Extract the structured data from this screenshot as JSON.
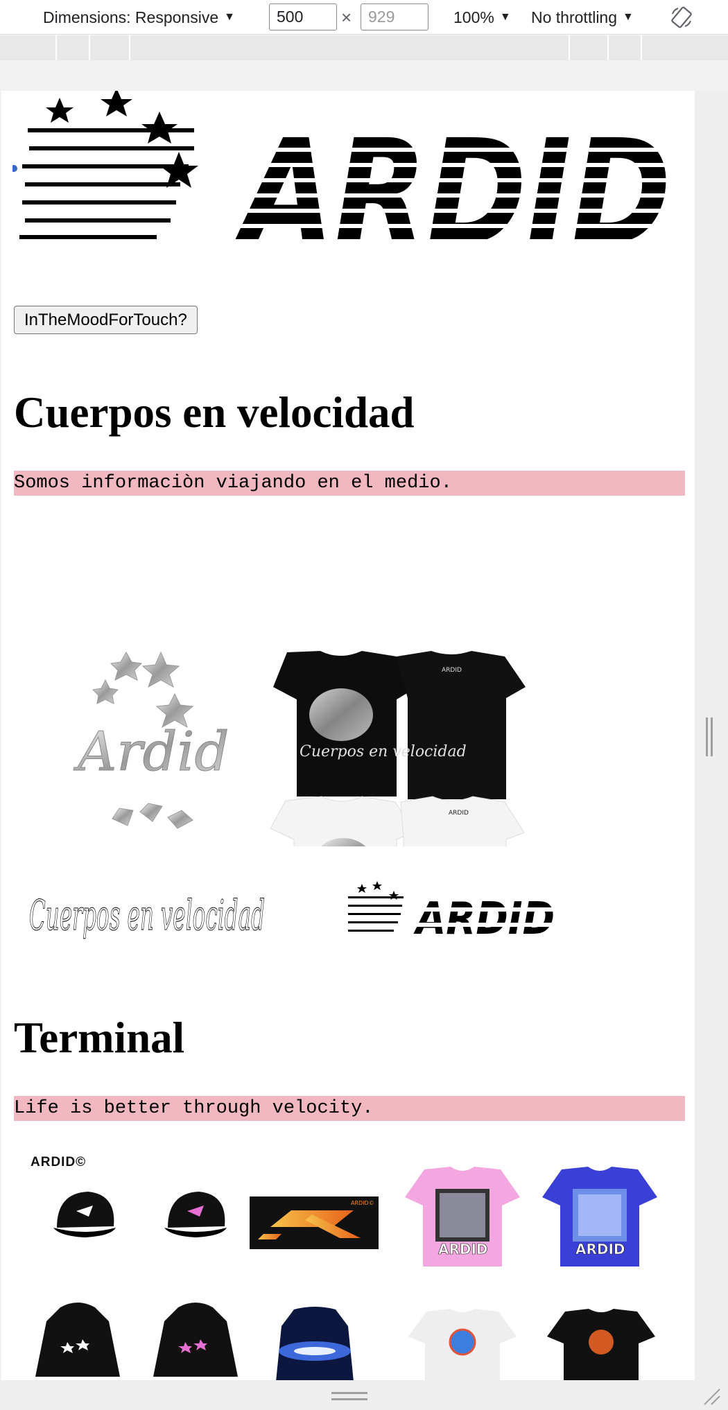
{
  "devtools": {
    "dimensions_label": "Dimensions: Responsive",
    "width_value": "500",
    "height_placeholder": "929",
    "times_symbol": "×",
    "zoom_label": "100%",
    "throttle_label": "No throttling",
    "caret": "▼",
    "rotate_icon": "rotate-device-icon"
  },
  "page": {
    "logo_text": "ARDID",
    "touch_button_label": "InTheMoodForTouch?",
    "section1": {
      "heading": "Cuerpos en velocidad",
      "tagline": "Somos informaciòn viajando en el medio.",
      "script_text": "Cuerpos en velocidad",
      "logo_small_text": "ARDID",
      "shirt_print_text": "Cuerpos en velocidad",
      "chrome_logo_text": "Ardid"
    },
    "section2": {
      "heading": "Terminal",
      "tagline": "Life is better through velocity.",
      "brand_mark": "ARDID©",
      "banner_brand": "ARDID©",
      "tee_brand": "ARDID"
    }
  },
  "colors": {
    "highlight": "#f2b8c2",
    "toolbar_bg": "#ffffff",
    "gutter_bg": "#f1f1f1",
    "pink_tee": "#f3a6e0",
    "blue_tee": "#3a3fd6",
    "orange_gradient": "#f08a24"
  }
}
